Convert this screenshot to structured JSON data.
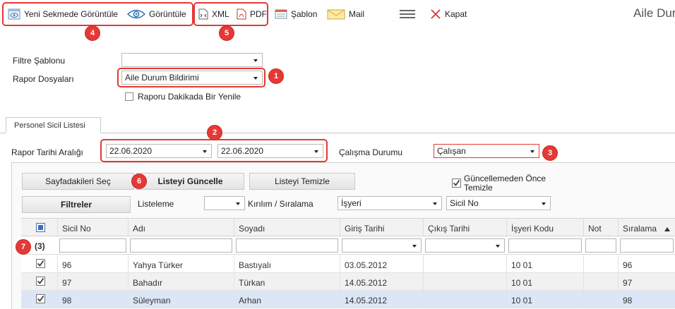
{
  "toolbar": {
    "open_new_tab": "Yeni Sekmede Görüntüle",
    "view": "Görüntüle",
    "xml": "XML",
    "pdf": "PDF",
    "template": "Şablon",
    "mail": "Mail",
    "close": "Kapat",
    "page_title": "Aile Dur"
  },
  "badges": [
    "1",
    "2",
    "3",
    "4",
    "5",
    "6",
    "7"
  ],
  "filters": {
    "filter_template_label": "Filtre Şablonu",
    "filter_template_value": "",
    "report_files_label": "Rapor Dosyaları",
    "report_files_value": "Aile Durum Bildirimi",
    "refresh_label": "Raporu Dakikada Bir Yenile"
  },
  "tabs": {
    "personnel": "Personel Sicil Listesi"
  },
  "criteria": {
    "date_range_label": "Rapor Tarihi Aralığı",
    "date_from": "22.06.2020",
    "date_to": "22.06.2020",
    "work_status_label": "Çalışma Durumu",
    "work_status_value": "Çalışan"
  },
  "actions": {
    "select_page": "Sayfadakileri Seç",
    "update_list": "Listeyi Güncelle",
    "clear_list": "Listeyi Temizle",
    "clear_before_update": "Güncellemeden Önce Temizle",
    "filters": "Filtreler",
    "listing_label": "Listeleme",
    "listing_value": "",
    "breakdown_label": "Kırılım / Sıralama",
    "breakdown_value": "İşyeri",
    "sort_value": "Sicil No"
  },
  "grid": {
    "columns": [
      "Sicil No",
      "Adı",
      "Soyadı",
      "Giriş Tarihi",
      "Çıkış Tarihi",
      "İşyeri Kodu",
      "Not",
      "Sıralama"
    ],
    "count": "(3)",
    "rows": [
      {
        "sicil": "96",
        "ad": "Yahya Türker",
        "soyad": "Bastıyalı",
        "giris": "03.05.2012",
        "cikis": "",
        "isyeri": "10 01",
        "not": "",
        "siralama": "96"
      },
      {
        "sicil": "97",
        "ad": "Bahadır",
        "soyad": "Türkan",
        "giris": "14.05.2012",
        "cikis": "",
        "isyeri": "10 01",
        "not": "",
        "siralama": "97"
      },
      {
        "sicil": "98",
        "ad": "Süleyman",
        "soyad": "Arhan",
        "giris": "14.05.2012",
        "cikis": "",
        "isyeri": "10 01",
        "not": "",
        "siralama": "98"
      }
    ]
  },
  "colors": {
    "annotation_red": "#e53935",
    "selected_row": "#dde6f7"
  }
}
